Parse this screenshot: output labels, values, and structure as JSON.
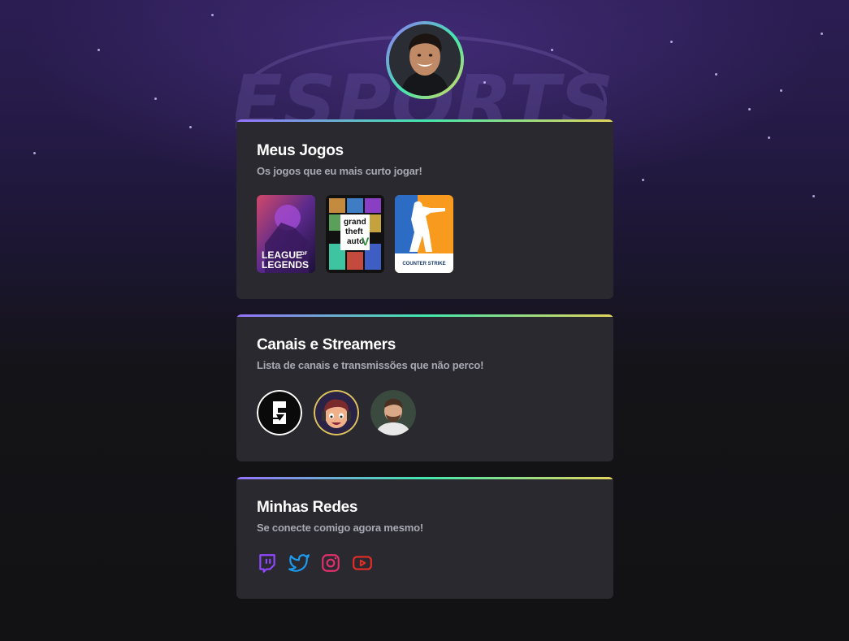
{
  "profile": {
    "avatar_alt": "avatar"
  },
  "games_card": {
    "title": "Meus Jogos",
    "subtitle": "Os jogos que eu mais curto jogar!",
    "games": [
      {
        "name": "League of Legends",
        "line1": "LEAGUE",
        "of": "OF",
        "line2": "LEGENDS"
      },
      {
        "name": "Grand Theft Auto V",
        "line1": "grand",
        "line2": "theft",
        "line3": "auto",
        "mark": "V"
      },
      {
        "name": "Counter-Strike",
        "label": "COUNTER STRIKE",
        "accent": "#f89a1e"
      }
    ]
  },
  "streamers_card": {
    "title": "Canais e Streamers",
    "subtitle": "Lista de canais e transmissões que não perco!",
    "streamers": [
      {
        "name": "rainbow-six-channel",
        "icon": "rainbow-six-logo"
      },
      {
        "name": "cartoon-streamer",
        "icon": "cartoon-avatar"
      },
      {
        "name": "streamer-photo",
        "icon": "person-avatar"
      }
    ]
  },
  "social_card": {
    "title": "Minhas Redes",
    "subtitle": "Se conecte comigo agora mesmo!",
    "links": [
      {
        "name": "twitch",
        "icon": "twitch-icon",
        "color": "#9147ff"
      },
      {
        "name": "twitter",
        "icon": "twitter-icon",
        "color": "#1d9bf0"
      },
      {
        "name": "instagram",
        "icon": "instagram-icon",
        "color": "#e1306c"
      },
      {
        "name": "youtube",
        "icon": "youtube-icon",
        "color": "#e52d27"
      }
    ]
  },
  "colors": {
    "background": "#121214",
    "card": "#29292f",
    "title": "#ffffff",
    "subtitle": "#a8a8b3",
    "gradient": [
      "#9572fc",
      "#43e7ad",
      "#e2d45c"
    ]
  }
}
